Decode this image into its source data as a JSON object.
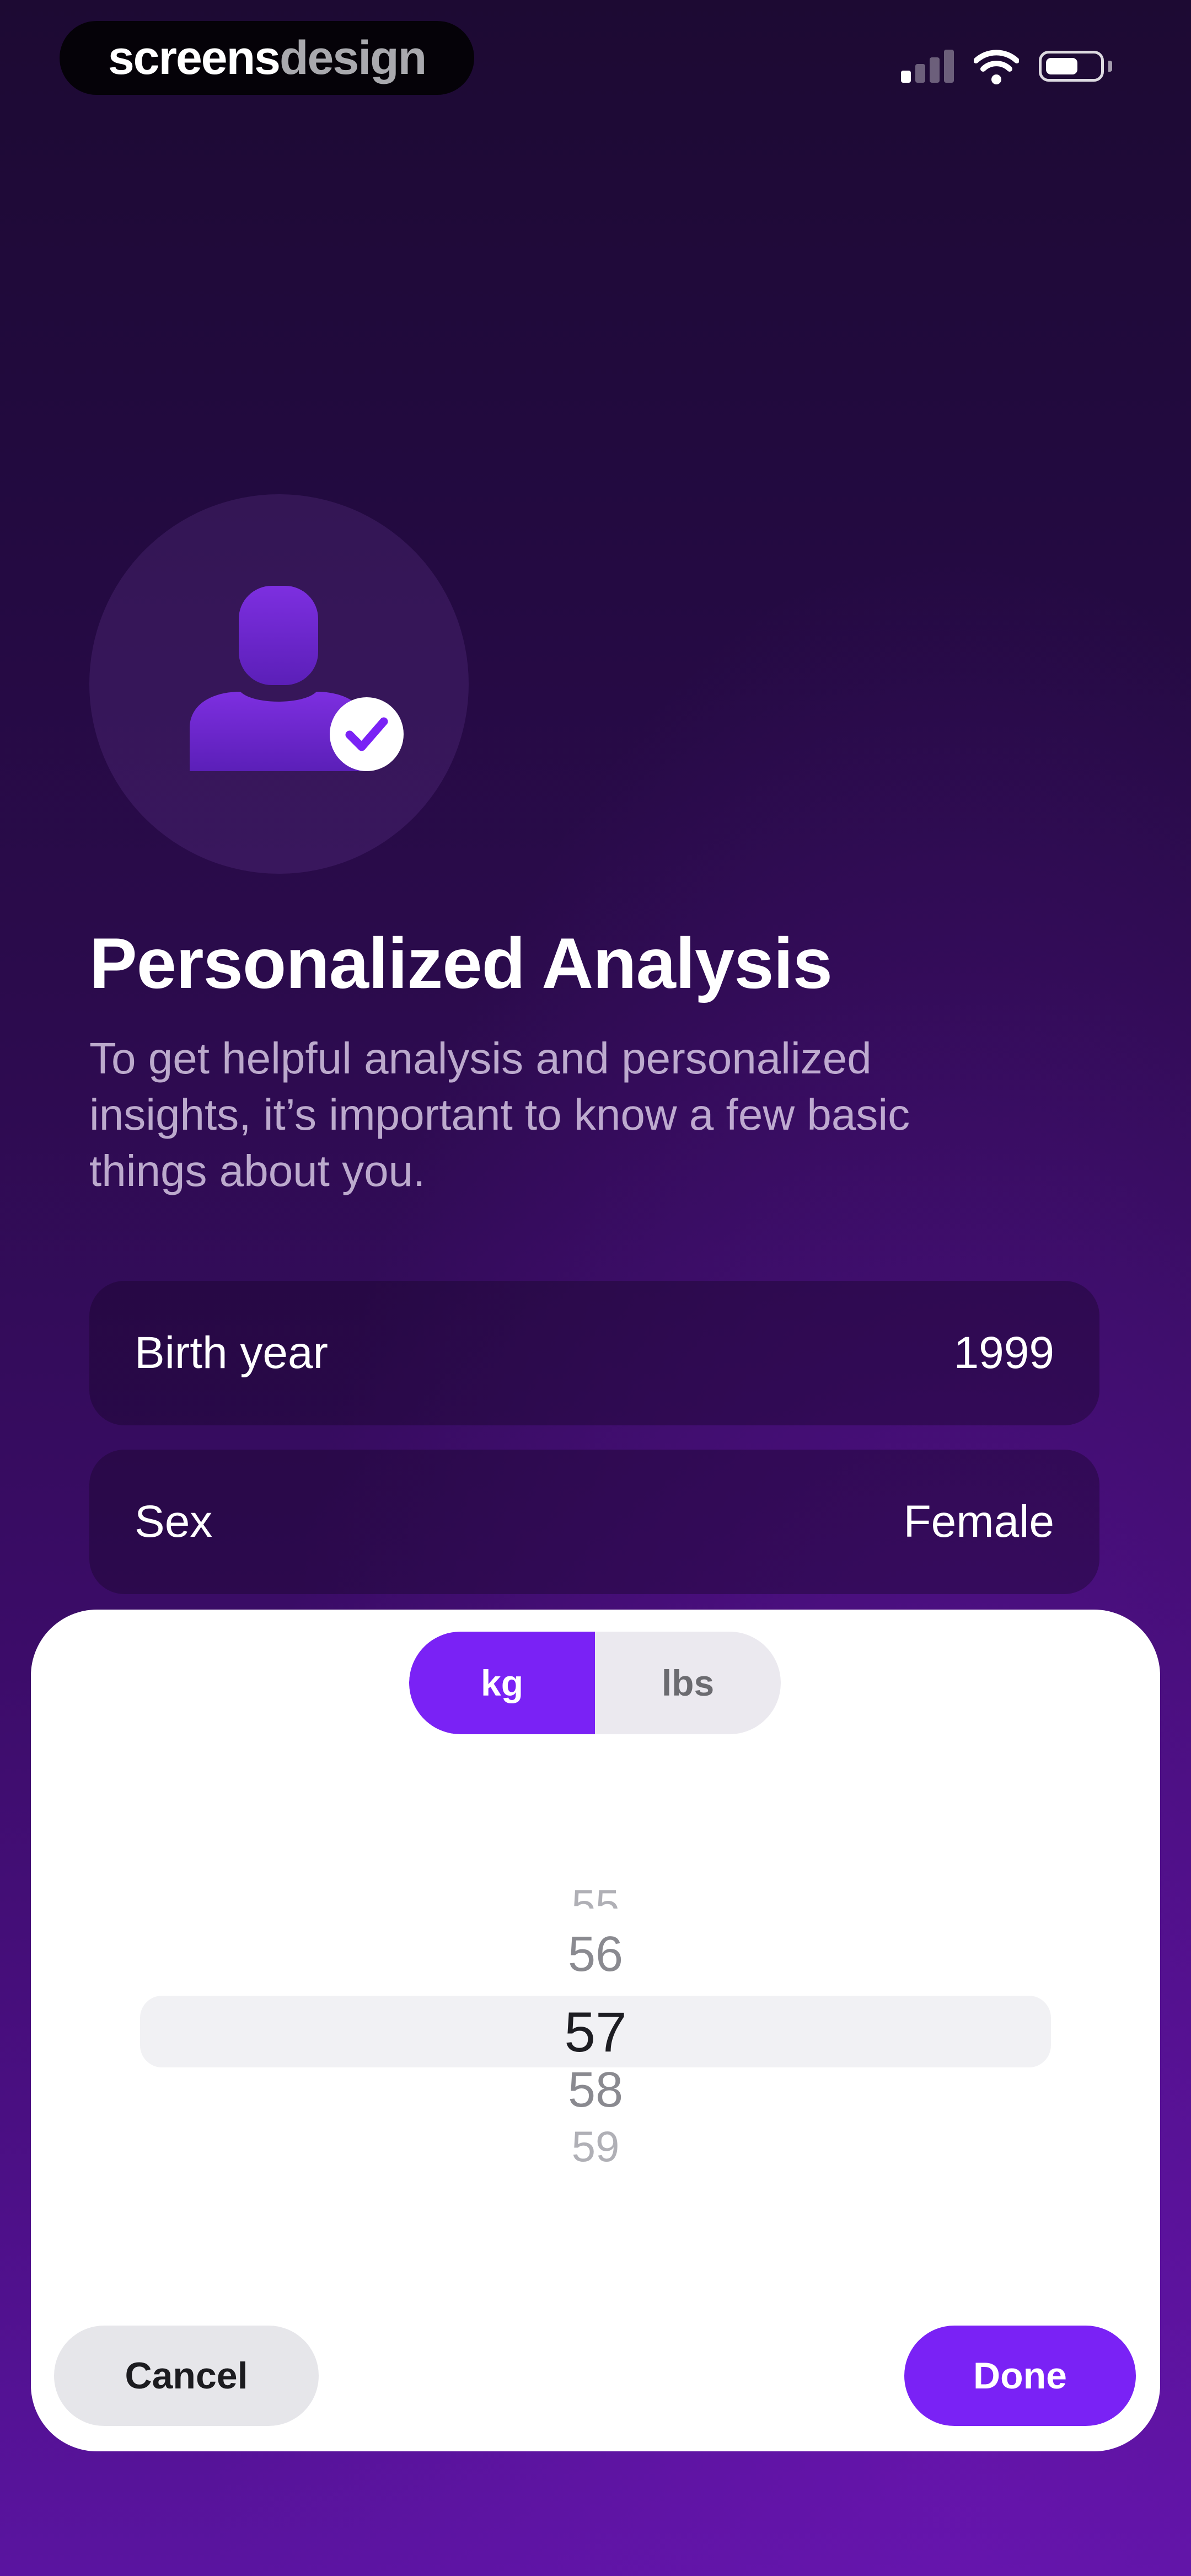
{
  "status_bar": {
    "brand_part_1": "screens",
    "brand_part_2": "design",
    "signal_icon": "cellular-signal-icon",
    "wifi_icon": "wifi-icon",
    "battery_icon": "battery-icon",
    "battery_level": 0.62
  },
  "hero": {
    "avatar_icon": "person-check-icon",
    "title": "Personalized Analysis",
    "subtitle": "To get helpful analysis and personalized insights, it’s important to know a few basic things about you."
  },
  "profile_rows": [
    {
      "label": "Birth year",
      "value": "1999"
    },
    {
      "label": "Sex",
      "value": "Female"
    }
  ],
  "weight_sheet": {
    "units": [
      "kg",
      "lbs"
    ],
    "selected_unit": "kg",
    "picker_values": [
      "55",
      "56",
      "57",
      "58",
      "59"
    ],
    "selected_value": "57",
    "cancel_label": "Cancel",
    "done_label": "Done"
  },
  "colors": {
    "accent": "#7A22F5",
    "background_top": "#1D0A33",
    "background_bottom": "#5A14A0",
    "sheet": "#FFFFFF"
  }
}
